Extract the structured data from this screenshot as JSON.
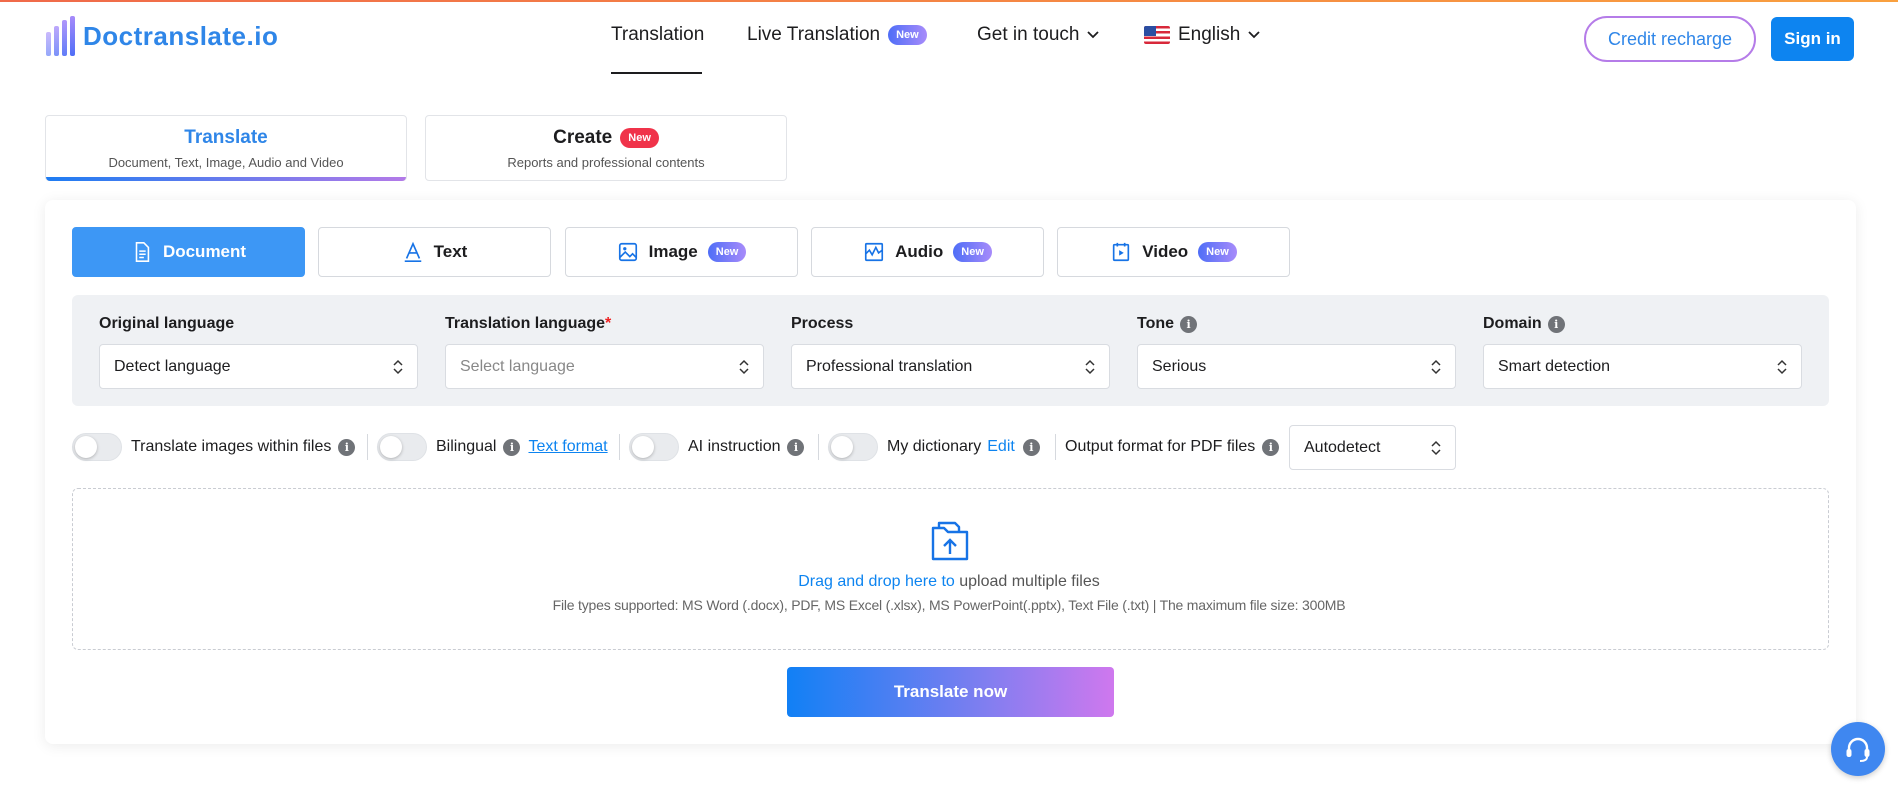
{
  "header": {
    "logo_text": "Doctranslate.io",
    "nav": {
      "translation": "Translation",
      "live_translation": "Live Translation",
      "live_badge": "New",
      "get_in_touch": "Get in touch",
      "language": "English"
    },
    "credit_recharge": "Credit recharge",
    "sign_in": "Sign in"
  },
  "modes": [
    {
      "title": "Translate",
      "subtitle": "Document, Text, Image, Audio and Video",
      "active": true
    },
    {
      "title": "Create",
      "subtitle": "Reports and professional contents",
      "badge": "New"
    }
  ],
  "tabs": [
    {
      "label": "Document",
      "icon": "document-icon",
      "active": true
    },
    {
      "label": "Text",
      "icon": "text-icon"
    },
    {
      "label": "Image",
      "icon": "image-icon",
      "badge": "New"
    },
    {
      "label": "Audio",
      "icon": "audio-icon",
      "badge": "New"
    },
    {
      "label": "Video",
      "icon": "video-icon",
      "badge": "New"
    }
  ],
  "options": {
    "original_language": {
      "label": "Original language",
      "value": "Detect language"
    },
    "translation_language": {
      "label": "Translation language",
      "required_mark": "*",
      "placeholder": "Select language"
    },
    "process": {
      "label": "Process",
      "value": "Professional translation"
    },
    "tone": {
      "label": "Tone",
      "value": "Serious"
    },
    "domain": {
      "label": "Domain",
      "value": "Smart detection"
    }
  },
  "toggles": {
    "translate_images": "Translate images within files",
    "bilingual": "Bilingual",
    "text_format_link": "Text format",
    "ai_instruction": "AI instruction",
    "my_dictionary": "My dictionary",
    "edit_link": "Edit",
    "output_format_label": "Output format for PDF files",
    "output_format_value": "Autodetect"
  },
  "dropzone": {
    "highlight": "Drag and drop here to",
    "rest": " upload multiple files",
    "supported": "File types supported: MS Word (.docx), PDF, MS Excel (.xlsx), MS PowerPoint(.pptx), Text File (.txt) | The maximum file size: 300MB"
  },
  "cta": "Translate now",
  "info_glyph": "i",
  "colors": {
    "primary": "#0d84f0",
    "accent_purple": "#b57ce8",
    "badge_red": "#f0334a"
  }
}
